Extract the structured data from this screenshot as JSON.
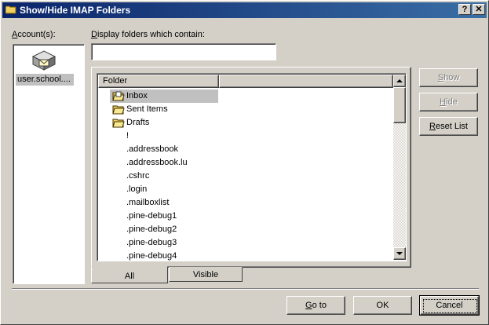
{
  "window": {
    "title": "Show/Hide IMAP Folders",
    "help_label": "?",
    "close_label": "✕"
  },
  "accounts": {
    "label_prefix": "A",
    "label_rest": "ccount(s):",
    "items": [
      "user.school...."
    ]
  },
  "filter": {
    "label_prefix": "D",
    "label_rest": "isplay folders which contain:",
    "value": ""
  },
  "list": {
    "header": "Folder",
    "folders": [
      {
        "name": "Inbox",
        "icon": "inbox-icon",
        "selected": true
      },
      {
        "name": "Sent Items",
        "icon": "folder-icon"
      },
      {
        "name": "Drafts",
        "icon": "folder-icon"
      },
      {
        "name": "!",
        "icon": ""
      },
      {
        "name": ".addressbook",
        "icon": ""
      },
      {
        "name": ".addressbook.lu",
        "icon": ""
      },
      {
        "name": ".cshrc",
        "icon": ""
      },
      {
        "name": ".login",
        "icon": ""
      },
      {
        "name": ".mailboxlist",
        "icon": ""
      },
      {
        "name": ".pine-debug1",
        "icon": ""
      },
      {
        "name": ".pine-debug2",
        "icon": ""
      },
      {
        "name": ".pine-debug3",
        "icon": ""
      },
      {
        "name": ".pine-debug4",
        "icon": ""
      }
    ]
  },
  "tabs": [
    {
      "label": "All",
      "active": true
    },
    {
      "label": "Visible",
      "active": false
    }
  ],
  "side_buttons": {
    "show": {
      "prefix": "S",
      "rest": "how",
      "enabled": false
    },
    "hide": {
      "prefix": "H",
      "rest": "ide",
      "enabled": false
    },
    "reset": {
      "prefix": "R",
      "rest": "eset List",
      "enabled": true
    }
  },
  "footer": {
    "goto": {
      "prefix": "G",
      "rest": "o to"
    },
    "ok": "OK",
    "cancel": "Cancel"
  },
  "colors": {
    "title_start": "#0a246a",
    "title_end": "#3a6ea5",
    "selection": "#c0c0c0",
    "face": "#d4d0c8"
  }
}
